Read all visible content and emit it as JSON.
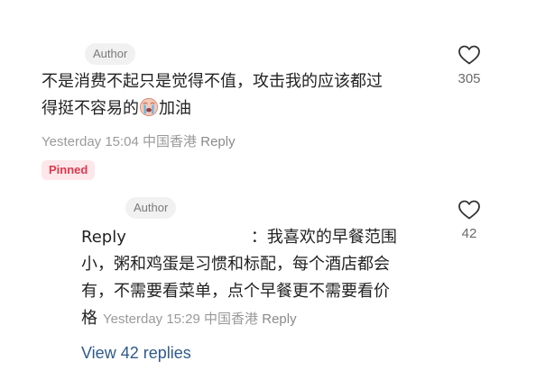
{
  "comment": {
    "author_badge": "Author",
    "text_line1": "不是消费不起只是觉得不值，攻击我的应该都过",
    "text_line2": "得挺不容易的",
    "text_line2_after_emoji": "加油",
    "emoji": "crying-face-emoji",
    "timestamp": "Yesterday 15:04",
    "location": "中国香港",
    "reply_label": "Reply",
    "like_count": "305",
    "pinned_label": "Pinned"
  },
  "reply": {
    "author_badge": "Author",
    "reply_prefix": "Reply",
    "colon_text": "：我喜欢的早餐范围",
    "text_line2": "小，粥和鸡蛋是习惯和标配，每个酒店都会",
    "text_line3": "有，不需要看菜单，点个早餐更不需要看价",
    "text_line4": "格",
    "timestamp": "Yesterday 15:29",
    "location": "中国香港",
    "reply_label": "Reply",
    "like_count": "42"
  },
  "view_replies_label": "View 42 replies",
  "colors": {
    "link": "#2e5a8a",
    "pinned_text": "#e0384d",
    "pinned_bg": "#fde7ea",
    "meta": "#9a9a9a"
  }
}
